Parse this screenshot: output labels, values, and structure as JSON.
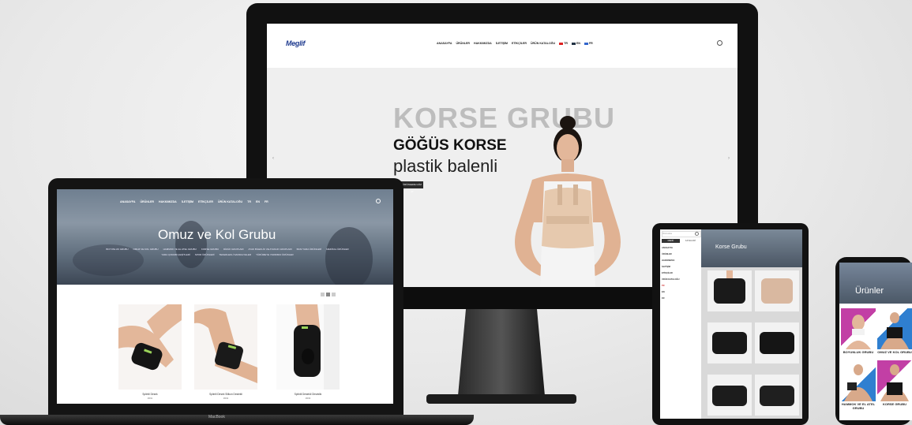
{
  "imac": {
    "logo": "Meglif",
    "menu": [
      "ANASAYFA",
      "ÜRÜNLER",
      "HAKKIMIZDA",
      "İLETİŞİM",
      "ETİKÇİLER",
      "ÜRÜN KATALOĞU"
    ],
    "langs": [
      "TR",
      "EN",
      "FR"
    ],
    "hero_title": "KORSE GRUBU",
    "hero_subtitle": "GÖĞÜS KORSE",
    "hero_desc": "plastik balenli",
    "hero_button": "ÜRÜNLERE GÖZ AT",
    "arrow_left": "‹",
    "arrow_right": "›"
  },
  "laptop": {
    "menu": [
      "ANASAYFA",
      "ÜRÜNLER",
      "HAKKIMIZDA",
      "İLETİŞİM",
      "ETİKÇİLER",
      "ÜRÜN KATALOĞU",
      "TR",
      "EN",
      "FR"
    ],
    "hero_title": "Omuz ve Kol Grubu",
    "categories": [
      "BOYUNLUK GRUBU",
      "OMUZ VE KOL GRUBU",
      "HAMMOK VE EL ATEL GRUBU",
      "KORSE GRUBU",
      "DİZLİK GRUPLARI",
      "AYAK BİLEKLİK VE AYAKLIK GRUPLARI",
      "BASI YARA ÜRÜNLERİ",
      "MEDİKAL ÜRÜNLER",
      "YARA ÇORABI ÇEŞİTLERİ",
      "SPOR ÜRÜNLERİ",
      "TEKERLEKLİ SANDALYELER",
      "YÜRÜMEYE YARDIMCI ÜRÜNLER"
    ],
    "products": [
      {
        "name": "Splintli Dirsek",
        "price": "M031"
      },
      {
        "name": "Splintli Dirsek Silikon Destekli",
        "price": "M032"
      },
      {
        "name": "Splintli Destekli Dirseklik",
        "price": "M033"
      }
    ],
    "brand": "MacBook"
  },
  "tablet": {
    "search_placeholder": "Ürün Ara",
    "tabs": [
      "MENÜ",
      "KATEGORİ"
    ],
    "menu": [
      "ANASAYFA",
      "ÜRÜNLER",
      "HAKKIMIZDA",
      "İLETİŞİM",
      "ETİKÇİLER",
      "ÜRÜN KATALOĞU",
      "TR",
      "EN",
      "FR"
    ],
    "hero_title": "Korse Grubu"
  },
  "phone": {
    "hero_title": "Ürünler",
    "tiles": [
      {
        "caption": "BOYUNLUK GRUBU",
        "color": "#c23fa5"
      },
      {
        "caption": "OMUZ VE KOL GRUBU",
        "color": "#2f7fd0"
      },
      {
        "caption": "HAMMOK VE EL ATEL GRUBU",
        "color": "#2f7fd0"
      },
      {
        "caption": "KORSE GRUBU",
        "color": "#c23fa5"
      }
    ]
  },
  "colors": {
    "accent_blue": "#1f3b8f",
    "magenta": "#c23fa5",
    "blue": "#2f7fd0"
  }
}
